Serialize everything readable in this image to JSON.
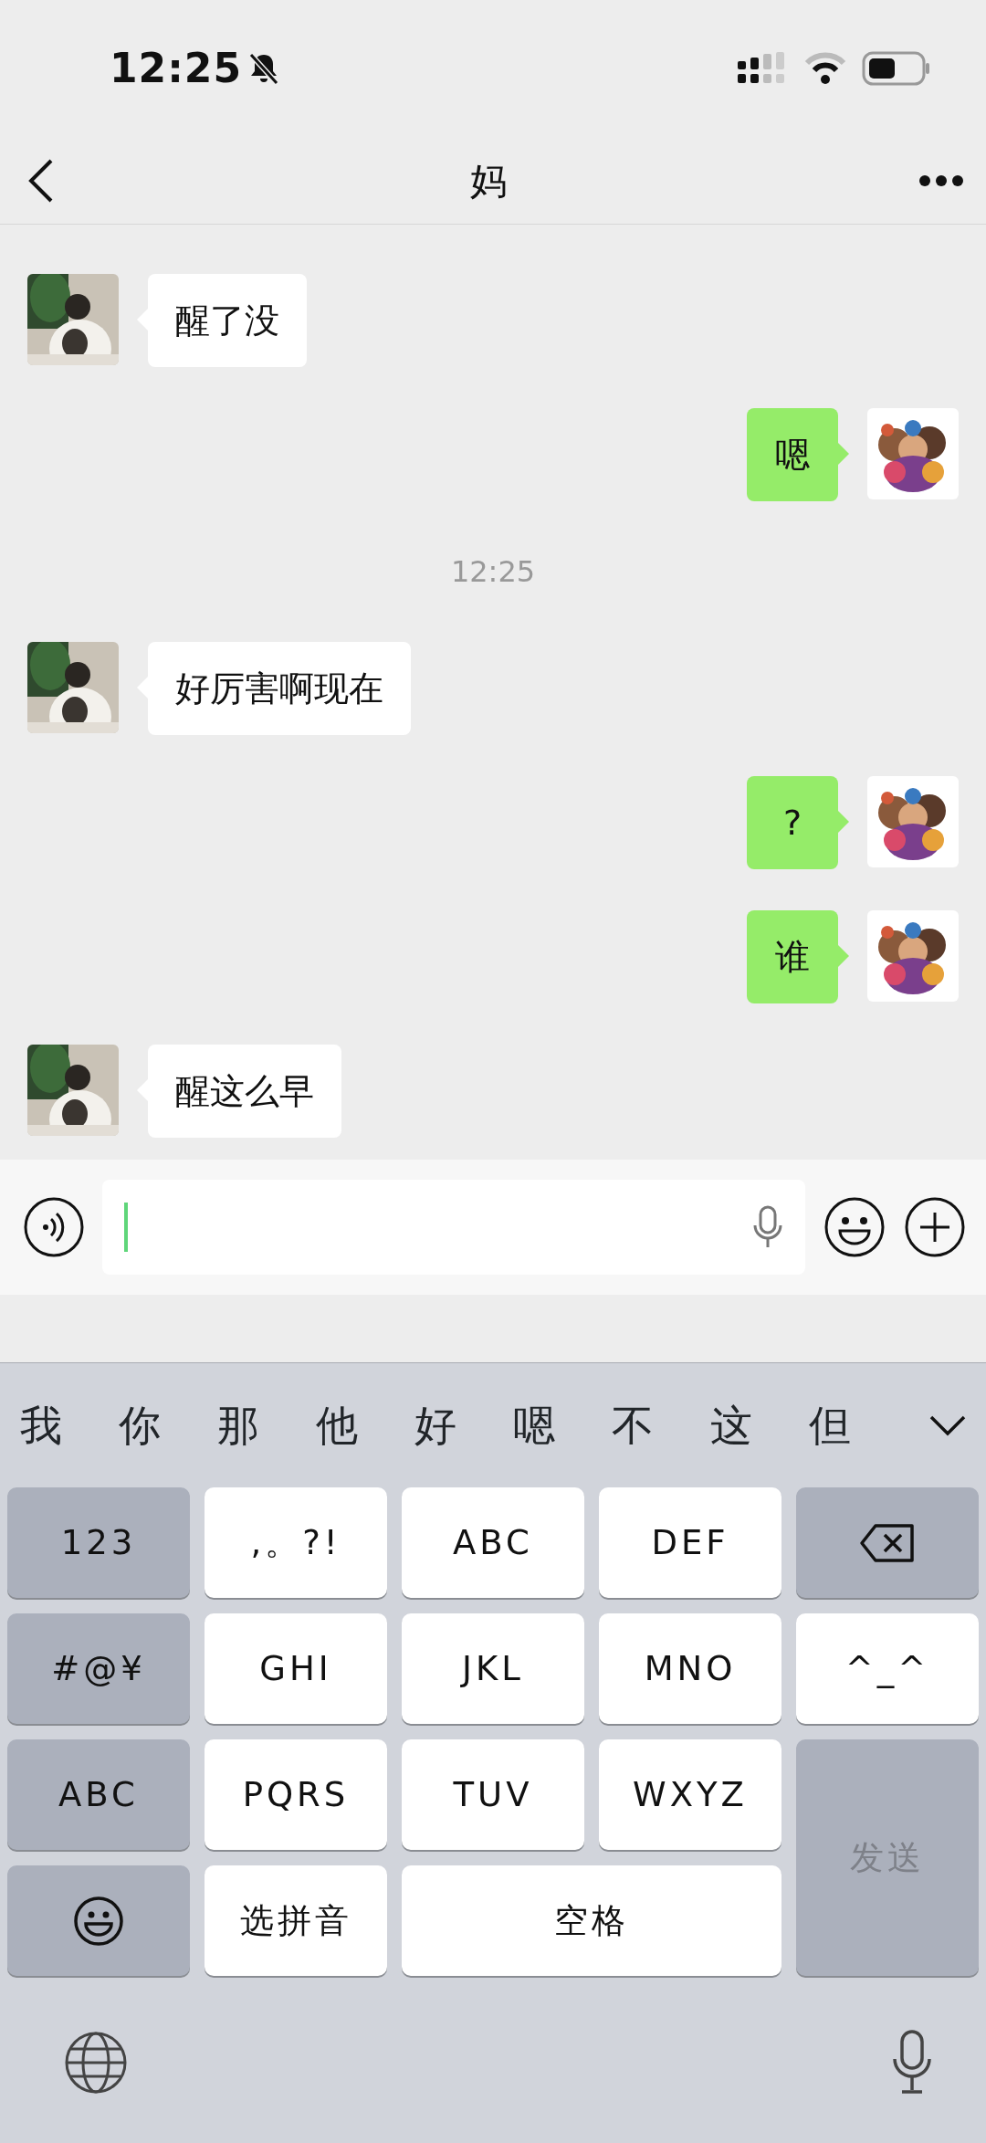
{
  "status_bar": {
    "time": "12:25",
    "muted": true
  },
  "header": {
    "title": "妈"
  },
  "messages": [
    {
      "kind": "incoming",
      "text": "醒了没"
    },
    {
      "kind": "outgoing",
      "text": "嗯"
    },
    {
      "kind": "time",
      "text": "12:25"
    },
    {
      "kind": "incoming",
      "text": "好厉害啊现在"
    },
    {
      "kind": "outgoing",
      "text": "?"
    },
    {
      "kind": "outgoing",
      "text": "谁"
    },
    {
      "kind": "incoming",
      "text": "醒这么早"
    }
  ],
  "keyboard": {
    "candidates": [
      "我",
      "你",
      "那",
      "他",
      "好",
      "嗯",
      "不",
      "这",
      "但"
    ],
    "keys": [
      {
        "kind": "function",
        "label": "123"
      },
      {
        "kind": "letter",
        "label": ",。?!"
      },
      {
        "kind": "letter",
        "label": "ABC"
      },
      {
        "kind": "letter",
        "label": "DEF"
      },
      {
        "kind": "delete"
      },
      {
        "kind": "function",
        "label": "#@¥"
      },
      {
        "kind": "letter",
        "label": "GHI"
      },
      {
        "kind": "letter",
        "label": "JKL"
      },
      {
        "kind": "letter",
        "label": "MNO"
      },
      {
        "kind": "letter",
        "label": "^_^"
      },
      {
        "kind": "function",
        "label": "ABC"
      },
      {
        "kind": "letter",
        "label": "PQRS"
      },
      {
        "kind": "letter",
        "label": "TUV"
      },
      {
        "kind": "letter",
        "label": "WXYZ"
      },
      {
        "kind": "send",
        "label": "发送"
      },
      {
        "kind": "emoji"
      },
      {
        "kind": "letter",
        "label": "选拼音"
      },
      {
        "kind": "space",
        "label": "空格"
      }
    ]
  }
}
